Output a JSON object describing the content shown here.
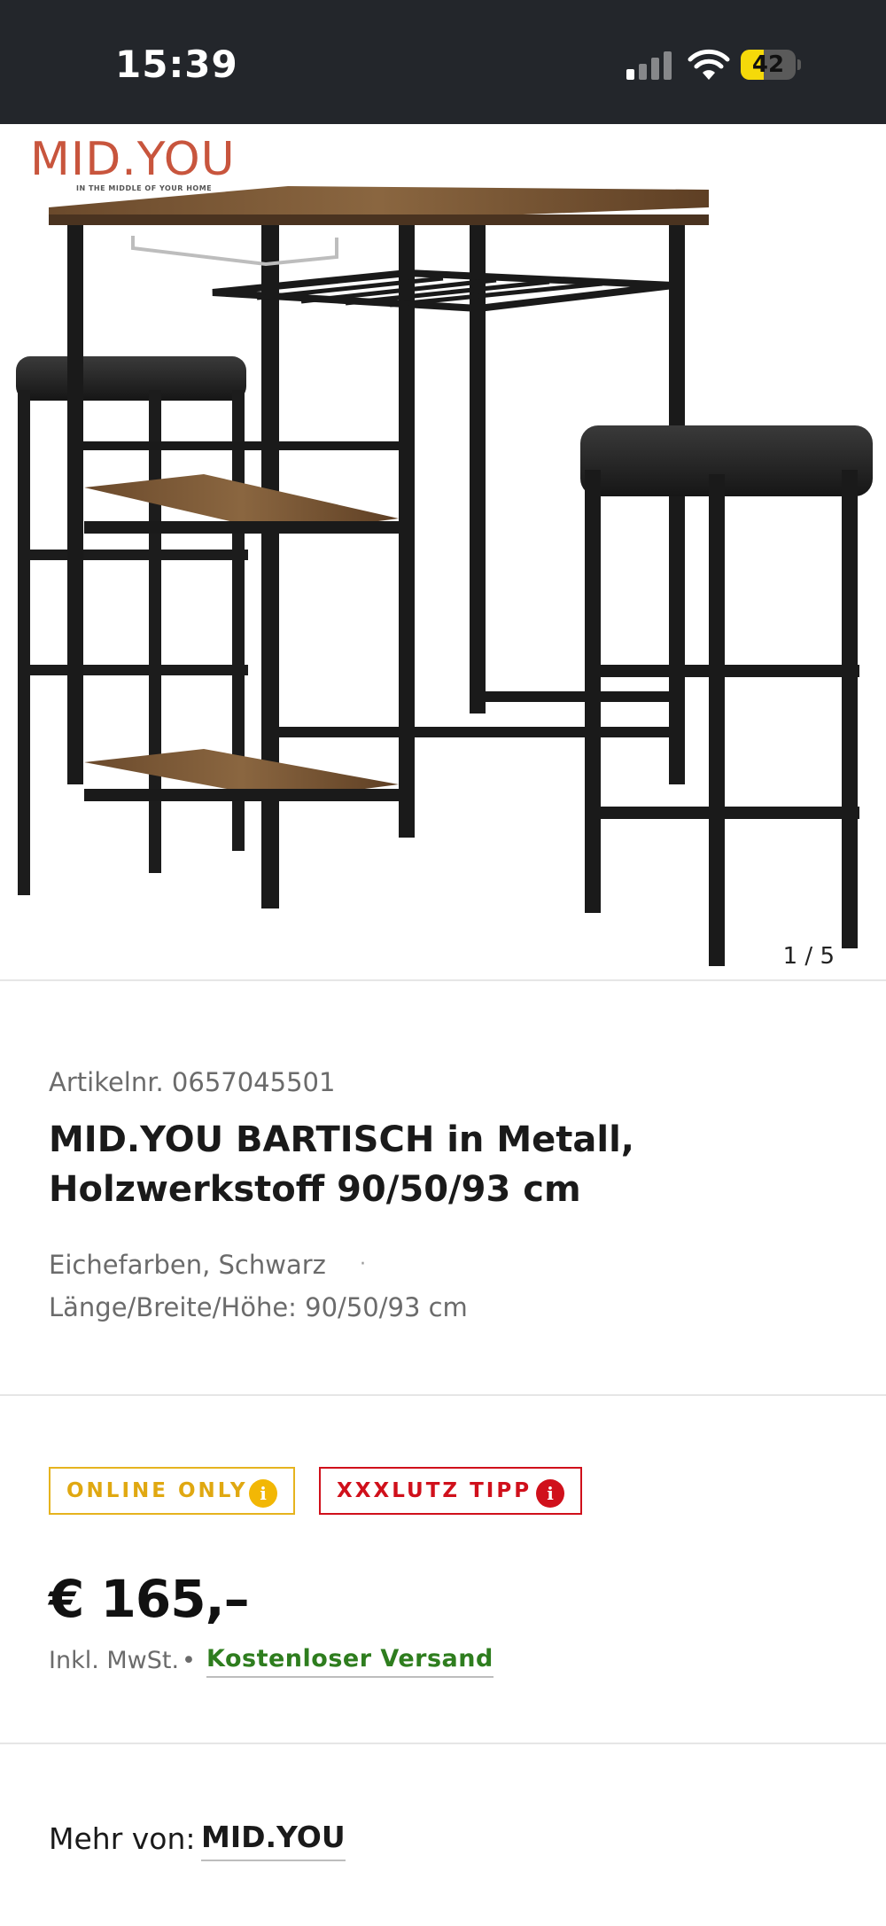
{
  "status_bar": {
    "time": "15:39",
    "battery_level": "42",
    "battery_fraction": 0.42,
    "icons": [
      "signal-icon",
      "wifi-icon",
      "battery-icon"
    ]
  },
  "gallery": {
    "brand_logo": "MID.YOU",
    "brand_tagline": "IN THE MIDDLE OF YOUR HOME",
    "image_counter": "1 / 5"
  },
  "product": {
    "article_number": "Artikelnr. 0657045501",
    "title_bold": "MID.YOU BARTISCH",
    "title_rest": " in Metall, Holzwerkstoff 90/50/93 cm",
    "variant": "Eichefarben, Schwarz",
    "variant_separator": "·",
    "dimensions": "Länge/Breite/Höhe: 90/50/93 cm"
  },
  "badges": {
    "online_only": "ONLINE ONLY",
    "xxxlutz_tipp": "XXXLUTZ TIPP",
    "info_glyph": "i",
    "colors": {
      "online_only": "#e0a811",
      "xxxlutz_tipp": "#d0101b"
    }
  },
  "pricing": {
    "price": "€ 165,–",
    "tax_note": "Inkl. MwSt.",
    "separator": "•",
    "shipping": "Kostenloser Versand",
    "shipping_color": "#2e7d1e"
  },
  "more_from": {
    "label": "Mehr von:",
    "brand": "MID.YOU"
  }
}
